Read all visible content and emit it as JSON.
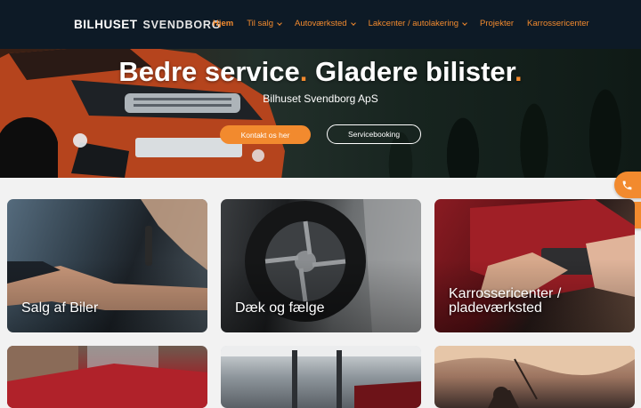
{
  "header": {
    "logo_primary": "BILHUSET",
    "logo_secondary": "SVENDBORG",
    "nav": [
      {
        "label": "Hjem",
        "dropdown": false,
        "active": true
      },
      {
        "label": "Til salg",
        "dropdown": true,
        "active": false
      },
      {
        "label": "Autoværksted",
        "dropdown": true,
        "active": false
      },
      {
        "label": "Lakcenter / autolakering",
        "dropdown": true,
        "active": false
      },
      {
        "label": "Projekter",
        "dropdown": false,
        "active": false
      },
      {
        "label": "Karrossericenter",
        "dropdown": false,
        "active": false
      }
    ]
  },
  "hero": {
    "title_part1": "Bedre service",
    "title_part2": "Gladere bilister",
    "title_dot": ".",
    "subtitle": "Bilhuset Svendborg ApS",
    "cta_primary": "Kontakt os her",
    "cta_secondary": "Servicebooking"
  },
  "floating_contact": {
    "phone_icon": "phone-icon",
    "mail_icon": "envelope-icon"
  },
  "cards": [
    {
      "label": "Salg af Biler"
    },
    {
      "label": "Dæk og fælge"
    },
    {
      "label": "Karrossericenter / pladeværksted"
    },
    {
      "label": ""
    },
    {
      "label": ""
    },
    {
      "label": ""
    }
  ],
  "colors": {
    "accent": "#f28a2e",
    "nav_background": "#0d1a26",
    "page_background": "#f2f2f2"
  }
}
